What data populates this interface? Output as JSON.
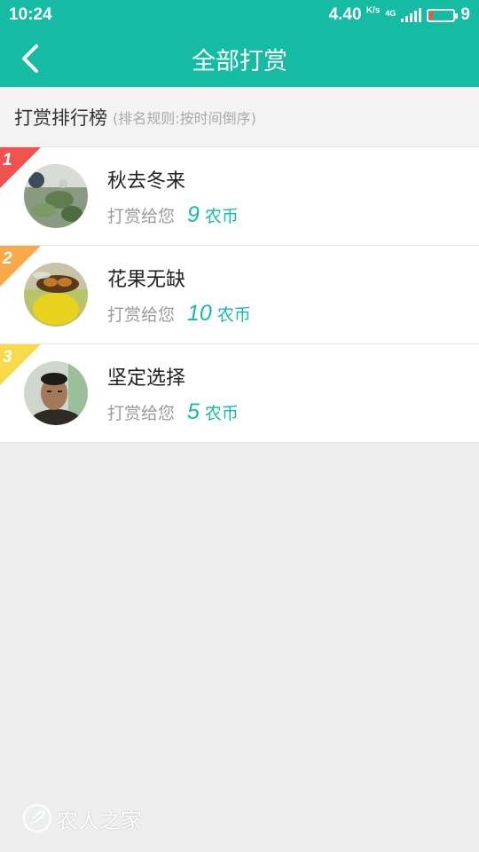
{
  "status_bar": {
    "time": "10:24",
    "speed": "4.40",
    "speed_unit": "K/s",
    "network": "4G",
    "battery_level": "9"
  },
  "app_bar": {
    "title": "全部打赏",
    "back_icon": "chevron-left-icon"
  },
  "section": {
    "title": "打赏排行榜",
    "note": "(排名规则:按时间倒序)"
  },
  "rewards": [
    {
      "rank": "1",
      "name": "秋去冬来",
      "label": "打赏给您",
      "amount": "9",
      "unit": "农币",
      "ribbon_color": "#ef5350"
    },
    {
      "rank": "2",
      "name": "花果无缺",
      "label": "打赏给您",
      "amount": "10",
      "unit": "农币",
      "ribbon_color": "#f8a94a"
    },
    {
      "rank": "3",
      "name": "坚定选择",
      "label": "打赏给您",
      "amount": "5",
      "unit": "农币",
      "ribbon_color": "#f7d94a"
    }
  ],
  "watermark": {
    "text": "农人之家",
    "icon": "leaf-logo-icon"
  },
  "colors": {
    "accent": "#15bba3",
    "background": "#eeeeee"
  }
}
